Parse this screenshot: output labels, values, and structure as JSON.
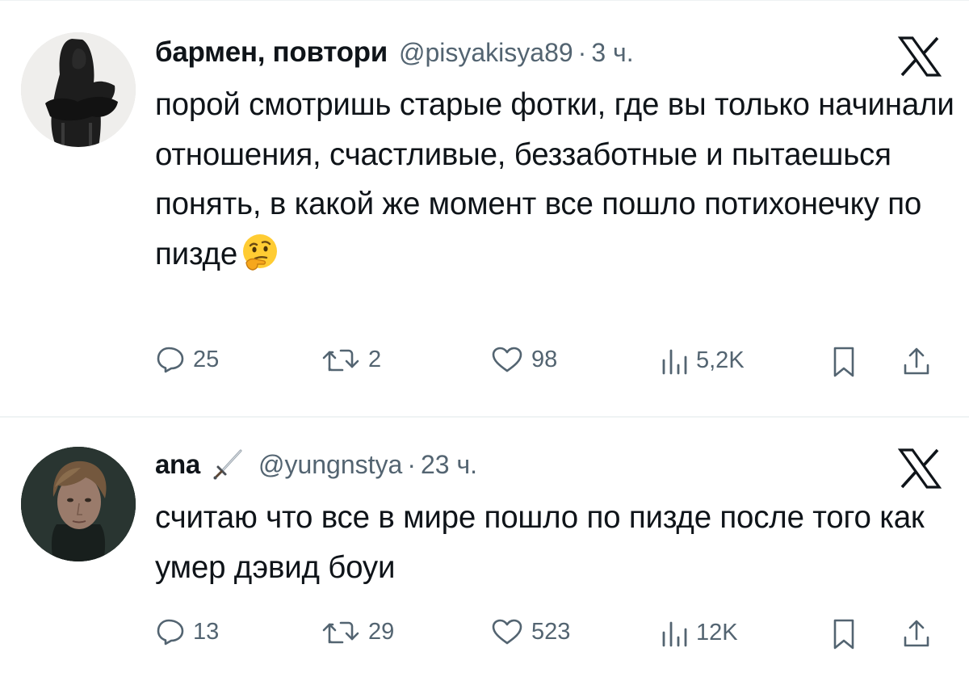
{
  "tweets": [
    {
      "name": "бармен, повтори",
      "handle": "@pisyakisya89",
      "separator": "·",
      "time": "3 ч.",
      "text": "порой смотришь старые фотки, где вы только начинали отношения, счастливые, беззаботные и пытаешься понять, в какой же момент все пошло потихонечку по пизде",
      "emoji": "thinking-face-emoji",
      "stats": {
        "replies": "25",
        "retweets": "2",
        "likes": "98",
        "views": "5,2K"
      }
    },
    {
      "name": "ana",
      "name_icon": "sword-icon",
      "handle": "@yungnstya",
      "separator": "·",
      "time": "23 ч.",
      "text": "считаю что все в мире пошло по пизде после того как умер дэвид боуи",
      "stats": {
        "replies": "13",
        "retweets": "29",
        "likes": "523",
        "views": "12K"
      }
    }
  ],
  "icons": [
    "x-logo-icon",
    "reply-icon",
    "retweet-icon",
    "like-icon",
    "views-icon",
    "bookmark-icon",
    "share-icon"
  ],
  "colors": {
    "text": "#0f1419",
    "secondary": "#536471",
    "divider": "#eff3f4",
    "background": "#ffffff"
  }
}
